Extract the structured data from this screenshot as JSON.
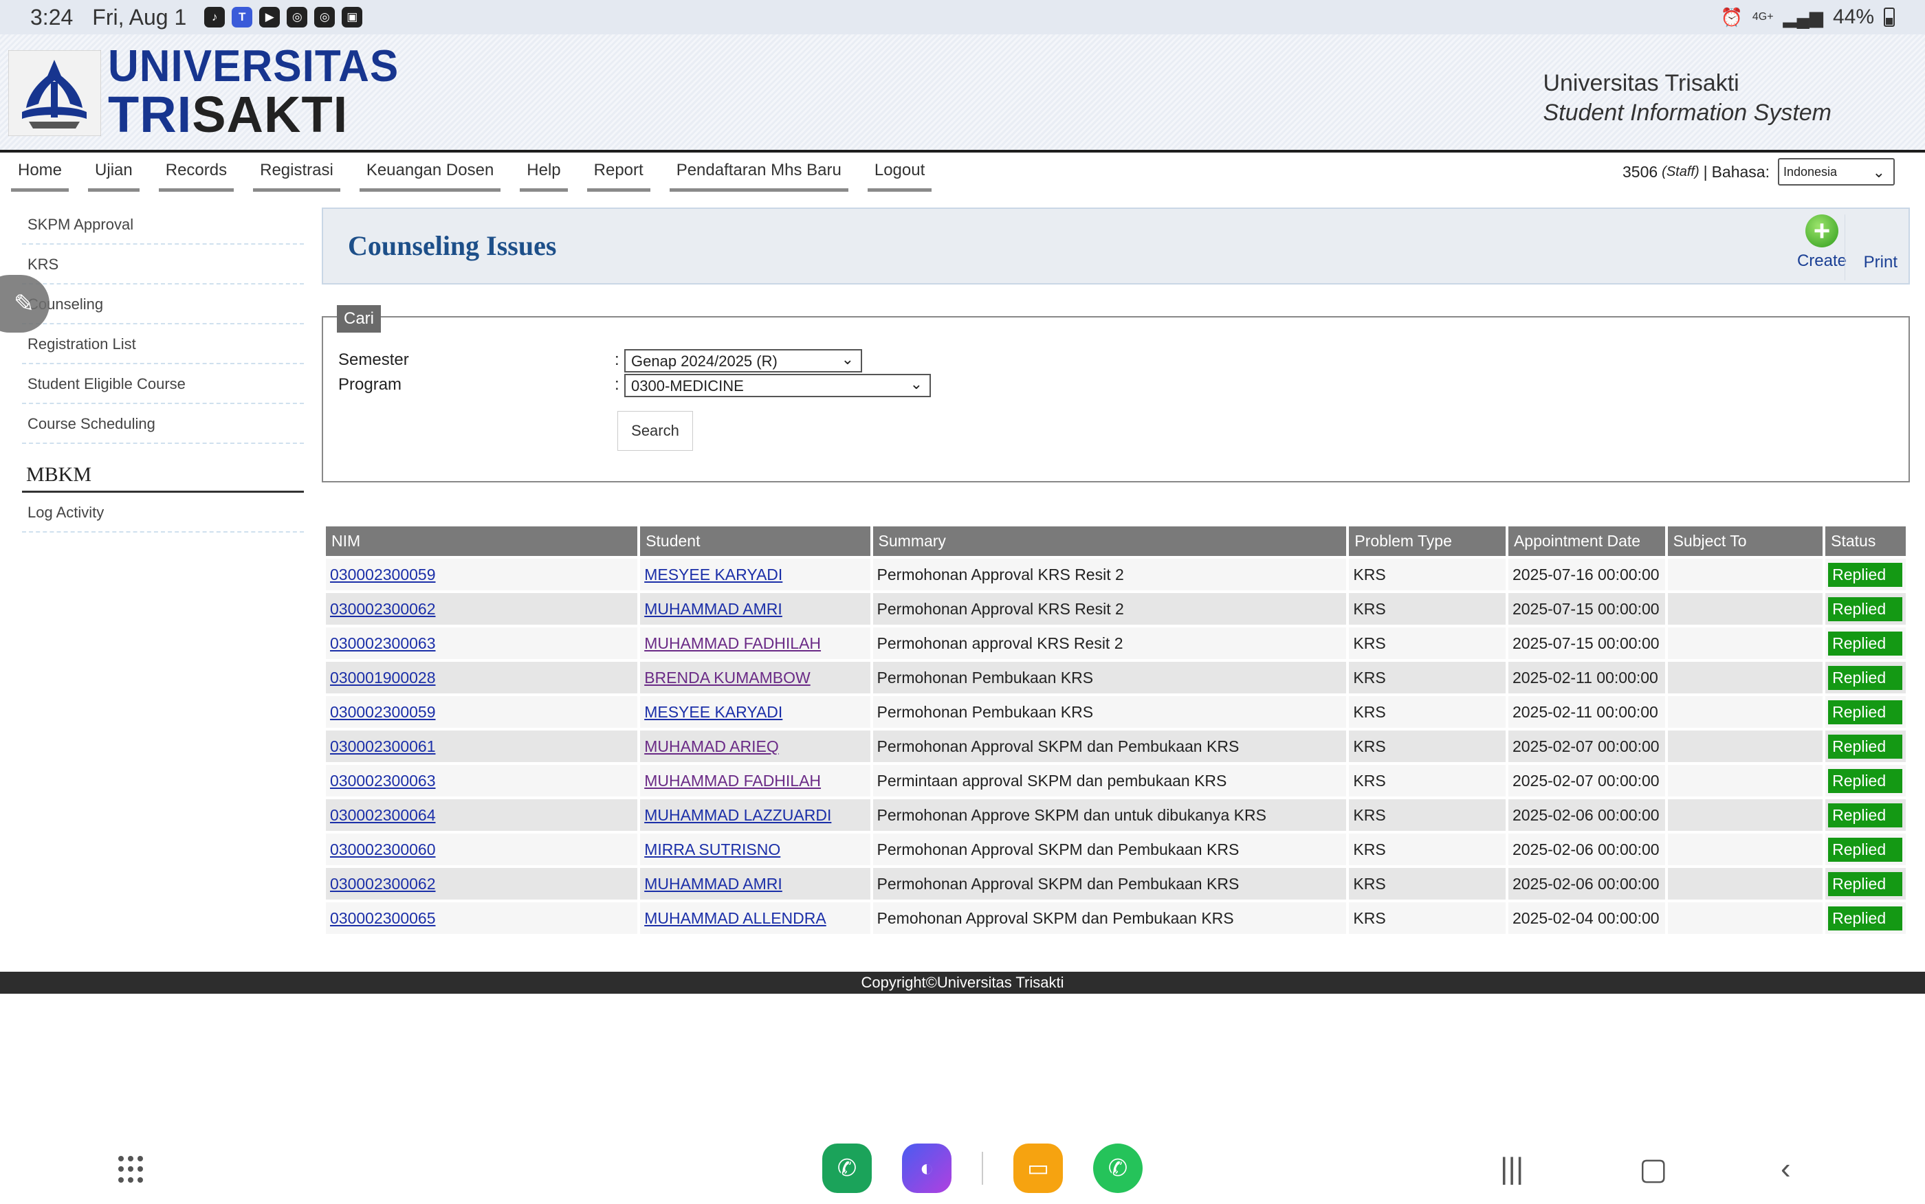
{
  "status_bar": {
    "time": "3:24",
    "date": "Fri, Aug 1",
    "battery": "44%",
    "network": "4G+"
  },
  "header": {
    "logo_line1": "UNIVERSITAS",
    "logo_line2_a": "TRI",
    "logo_line2_b": "SAKTI",
    "title_line1": "Universitas Trisakti",
    "title_line2": "Student Information System"
  },
  "menu": {
    "items": [
      "Home",
      "Ujian",
      "Records",
      "Registrasi",
      "Keuangan Dosen",
      "Help",
      "Report",
      "Pendaftaran Mhs Baru",
      "Logout"
    ],
    "user_id": "3506",
    "user_role": "(Staff)",
    "separator": "|",
    "language_label": "Bahasa:",
    "language_value": "Indonesia"
  },
  "sidebar": {
    "items": [
      "SKPM Approval",
      "KRS",
      "Counseling",
      "Registration List",
      "Student Eligible Course",
      "Course Scheduling"
    ],
    "section_heading": "MBKM",
    "section_items": [
      "Log Activity"
    ]
  },
  "page": {
    "title": "Counseling Issues",
    "create_label": "Create",
    "print_label": "Print"
  },
  "search": {
    "legend": "Cari",
    "semester_label": "Semester",
    "semester_value": "Genap 2024/2025 (R)",
    "program_label": "Program",
    "program_value": "0300-MEDICINE",
    "colon": ":",
    "button_label": "Search"
  },
  "table": {
    "headers": [
      "NIM",
      "Student",
      "Summary",
      "Problem Type",
      "Appointment Date",
      "Subject To",
      "Status"
    ],
    "rows": [
      {
        "nim": "030002300059",
        "student": "MESYEE KARYADI",
        "summary": "Permohonan Approval KRS Resit 2",
        "type": "KRS",
        "date": "2025-07-16 00:00:00",
        "subject": "",
        "status": "Replied"
      },
      {
        "nim": "030002300062",
        "student": "MUHAMMAD AMRI",
        "summary": "Permohonan Approval KRS Resit 2",
        "type": "KRS",
        "date": "2025-07-15 00:00:00",
        "subject": "",
        "status": "Replied"
      },
      {
        "nim": "030002300063",
        "student": "MUHAMMAD FADHILAH",
        "summary": "Permohonan approval KRS Resit 2",
        "type": "KRS",
        "date": "2025-07-15 00:00:00",
        "subject": "",
        "status": "Replied"
      },
      {
        "nim": "030001900028",
        "student": "BRENDA KUMAMBOW",
        "summary": "Permohonan Pembukaan KRS",
        "type": "KRS",
        "date": "2025-02-11 00:00:00",
        "subject": "",
        "status": "Replied"
      },
      {
        "nim": "030002300059",
        "student": "MESYEE KARYADI",
        "summary": "Permohonan Pembukaan KRS",
        "type": "KRS",
        "date": "2025-02-11 00:00:00",
        "subject": "",
        "status": "Replied"
      },
      {
        "nim": "030002300061",
        "student": "MUHAMAD ARIEQ",
        "summary": "Permohonan Approval SKPM dan Pembukaan KRS",
        "type": "KRS",
        "date": "2025-02-07 00:00:00",
        "subject": "",
        "status": "Replied"
      },
      {
        "nim": "030002300063",
        "student": "MUHAMMAD FADHILAH",
        "summary": "Permintaan approval SKPM dan pembukaan KRS",
        "type": "KRS",
        "date": "2025-02-07 00:00:00",
        "subject": "",
        "status": "Replied"
      },
      {
        "nim": "030002300064",
        "student": "MUHAMMAD LAZZUARDI",
        "summary": "Permohonan Approve SKPM dan untuk dibukanya KRS",
        "type": "KRS",
        "date": "2025-02-06 00:00:00",
        "subject": "",
        "status": "Replied"
      },
      {
        "nim": "030002300060",
        "student": "MIRRA SUTRISNO",
        "summary": "Permohonan Approval SKPM dan Pembukaan KRS",
        "type": "KRS",
        "date": "2025-02-06 00:00:00",
        "subject": "",
        "status": "Replied"
      },
      {
        "nim": "030002300062",
        "student": "MUHAMMAD AMRI",
        "summary": "Permohonan Approval SKPM dan Pembukaan KRS",
        "type": "KRS",
        "date": "2025-02-06 00:00:00",
        "subject": "",
        "status": "Replied"
      },
      {
        "nim": "030002300065",
        "student": "MUHAMMAD ALLENDRA",
        "summary": "Pemohonan Approval SKPM dan Pembukaan KRS",
        "type": "KRS",
        "date": "2025-02-04 00:00:00",
        "subject": "",
        "status": "Replied"
      }
    ]
  },
  "footer": {
    "copyright": "Copyright©Universitas Trisakti"
  },
  "colors": {
    "brand_blue": "#17358f",
    "title_blue": "#1d4f89",
    "status_green": "#149914",
    "header_gray": "#7a7a7a",
    "link_blue": "#1b2fa8",
    "link_visited": "#6a2a86"
  },
  "icons": {
    "status_apps": [
      "tiktok-icon",
      "teams-icon",
      "youtube-icon",
      "instagram-icon",
      "instagram-icon",
      "gallery-icon"
    ],
    "dock_apps": [
      "phone-icon",
      "browser-icon",
      "files-icon",
      "whatsapp-icon"
    ]
  }
}
